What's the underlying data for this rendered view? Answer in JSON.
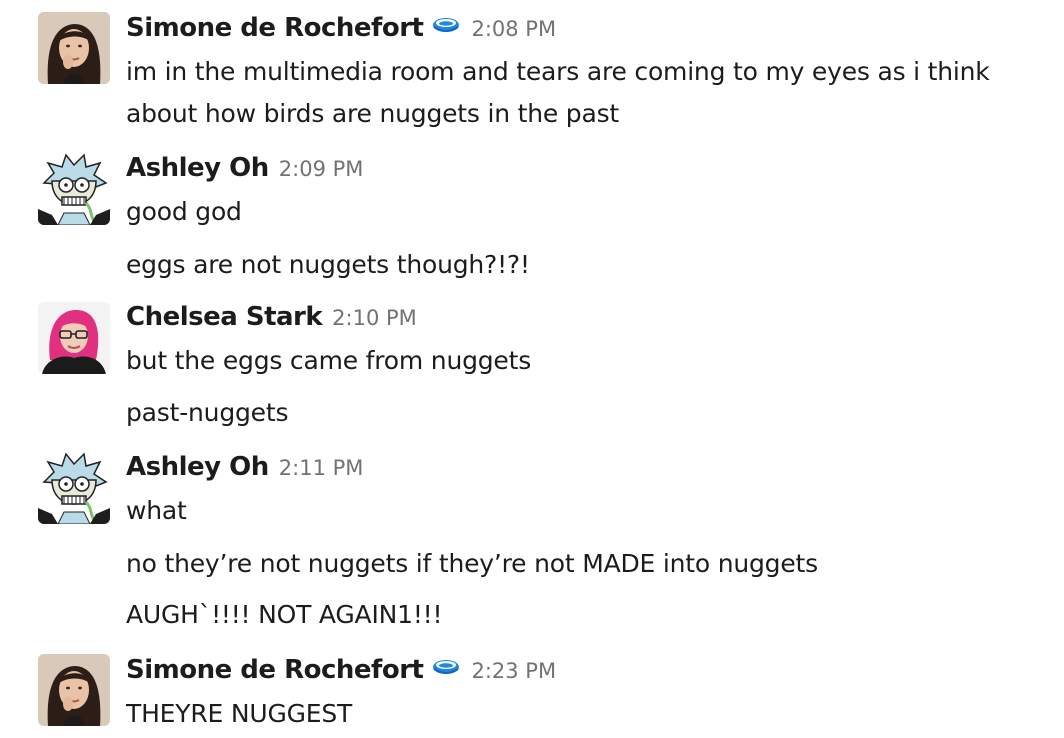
{
  "messages": [
    {
      "sender": "Simone de Rochefort",
      "avatar_icon": "avatar-simone",
      "status_icon": "blue-bowl-emoji",
      "time": "2:08 PM",
      "lines": [
        "im in the multimedia room and tears are coming to my eyes as i think",
        "about how birds are nuggets in the past"
      ]
    },
    {
      "sender": "Ashley Oh",
      "avatar_icon": "avatar-rick-cartoon",
      "time": "2:09 PM",
      "lines": [
        "good god",
        "eggs are not nuggets though?!?!"
      ]
    },
    {
      "sender": "Chelsea Stark",
      "avatar_icon": "avatar-chelsea",
      "time": "2:10 PM",
      "lines": [
        "but the eggs came from nuggets",
        "past-nuggets"
      ]
    },
    {
      "sender": "Ashley Oh",
      "avatar_icon": "avatar-rick-cartoon",
      "time": "2:11 PM",
      "lines": [
        "what",
        "no they’re not nuggets if they’re not MADE into nuggets",
        "AUGH`!!!! NOT AGAIN1!!!"
      ]
    },
    {
      "sender": "Simone de Rochefort",
      "avatar_icon": "avatar-simone",
      "status_icon": "blue-bowl-emoji",
      "time": "2:23 PM",
      "lines": [
        "THEYRE NUGGEST"
      ]
    }
  ],
  "colors": {
    "text": "#1d1c1d",
    "timestamp": "#717274",
    "emoji_blue": "#1e88e5",
    "background": "#ffffff"
  }
}
